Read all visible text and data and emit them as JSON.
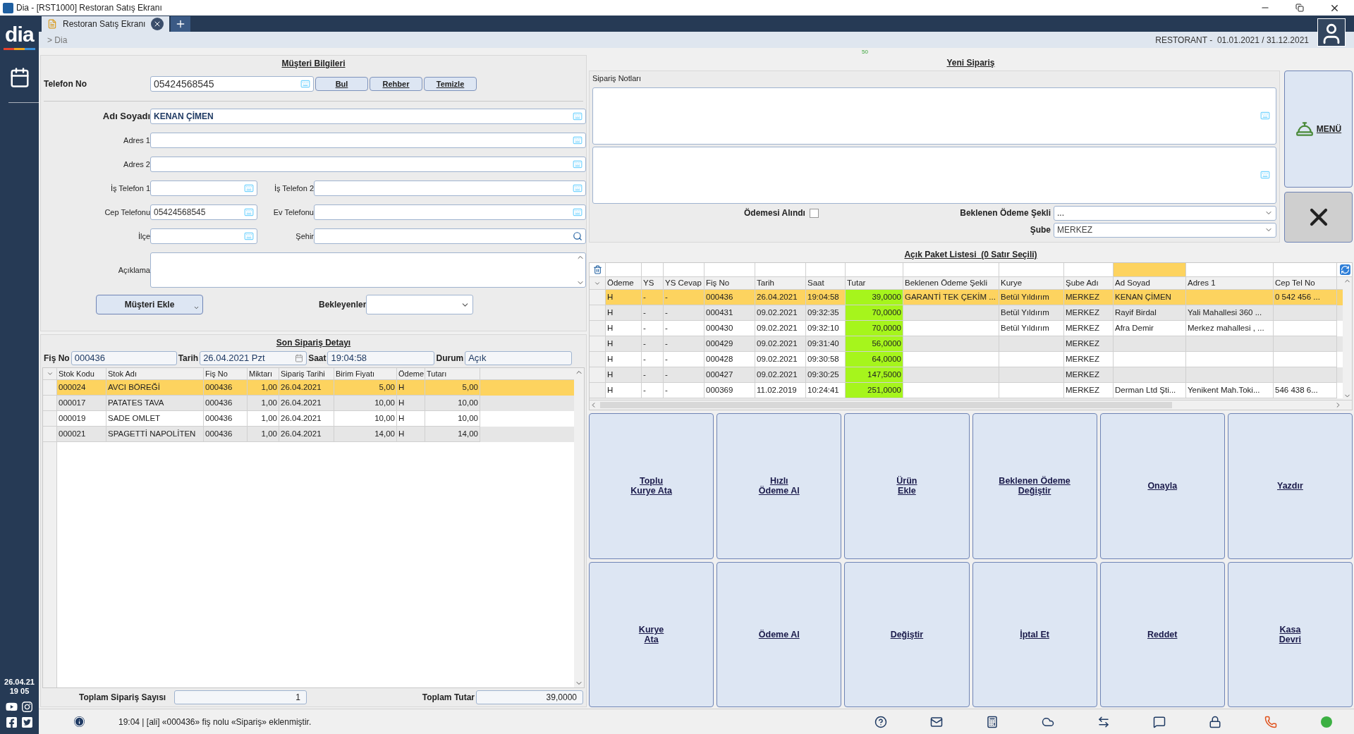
{
  "window": {
    "title": "Dia - [RST1000] Restoran Satış Ekranı"
  },
  "tabs": [
    {
      "label": "Restoran Satış Ekranı",
      "selected": true
    }
  ],
  "breadcrumb": "> Dia",
  "period": "RESTORANT -  01.01.2021 / 31.12.2021",
  "indicator": "50",
  "sidebar": {
    "logo": "dia",
    "date": "26.04.21",
    "time": "19 05"
  },
  "customer": {
    "title": "Müşteri Bilgileri",
    "phone_label": "Telefon No",
    "phone": "05424568545",
    "buttons": [
      "Bul",
      "Rehber",
      "Temizle"
    ],
    "rows": [
      {
        "fields": [
          {
            "label": "Adı Soyadı",
            "value": "KENAN ÇİMEN",
            "bold": true,
            "kind": "keyboard"
          }
        ]
      },
      {
        "fields": [
          {
            "label": "Adres 1",
            "bold": false,
            "kind": "keyboard"
          }
        ]
      },
      {
        "fields": [
          {
            "label": "Adres 2",
            "bold": false,
            "kind": "keyboard"
          }
        ]
      },
      {
        "fields": [
          {
            "label": "İş Telefon 1",
            "bold": false,
            "kind": "keyboard"
          },
          {
            "label": "İş Telefon 2",
            "bold": false,
            "kind": "keyboard"
          }
        ]
      },
      {
        "fields": [
          {
            "label": "Cep Telefonu",
            "value": "05424568545",
            "bold": false,
            "kind": "keyboard"
          },
          {
            "label": "Ev Telefonu",
            "bold": false,
            "kind": "keyboard"
          }
        ]
      },
      {
        "fields": [
          {
            "label": "İlçe",
            "bold": false,
            "kind": "keyboard"
          },
          {
            "label": "Şehir",
            "bold": false,
            "kind": "search"
          }
        ]
      }
    ],
    "note_label": "Açıklama",
    "add_button": "Müşteri Ekle",
    "waiting_label": "Bekleyenler"
  },
  "last_order": {
    "title": "Son Sipariş Detayı",
    "fields": [
      {
        "label": "Fiş No",
        "value": "000436",
        "kind": "text"
      },
      {
        "label": "Tarih",
        "value": "26.04.2021 Pzt",
        "kind": "date"
      },
      {
        "label": "Saat",
        "value": "19:04:58",
        "kind": "text"
      },
      {
        "label": "Durum",
        "value": "Açık",
        "kind": "text"
      }
    ],
    "columns": [
      "Stok Kodu",
      "Stok Adı",
      "Fiş No",
      "Miktarı",
      "Sipariş Tarihi",
      "Birim Fiyatı",
      "Ödeme",
      "Tutarı"
    ],
    "rows": [
      {
        "selected": true,
        "cells": [
          "000024",
          "AVCI BÖREĞİ",
          "000436",
          "1,00",
          "26.04.2021",
          "5,00",
          "H",
          "5,00"
        ]
      },
      {
        "selected": false,
        "cells": [
          "000017",
          "PATATES TAVA",
          "000436",
          "1,00",
          "26.04.2021",
          "10,00",
          "H",
          "10,00"
        ]
      },
      {
        "selected": false,
        "cells": [
          "000019",
          "SADE OMLET",
          "000436",
          "1,00",
          "26.04.2021",
          "10,00",
          "H",
          "10,00"
        ]
      },
      {
        "selected": false,
        "cells": [
          "000021",
          "SPAGETTİ NAPOLİTEN",
          "000436",
          "1,00",
          "26.04.2021",
          "14,00",
          "H",
          "14,00"
        ]
      }
    ],
    "count_label": "Toplam Sipariş Sayısı",
    "count": "1",
    "total_label": "Toplam Tutar",
    "total": "39,0000"
  },
  "new_order": {
    "title": "Yeni Sipariş",
    "notes_label": "Sipariş Notları",
    "paid_label": "Ödemesi Alındı",
    "paid": false,
    "payment_label": "Beklenen Ödeme Şekli",
    "payment": "...",
    "branch_label": "Şube",
    "branch": "MERKEZ",
    "menu_button": "MENÜ"
  },
  "open_list": {
    "title": "Açık Paket Listesi  (0 Satır Seçili)",
    "columns": [
      {
        "label": "Ödeme",
        "filtered": false
      },
      {
        "label": "YS",
        "filtered": false
      },
      {
        "label": "YS Cevap",
        "filtered": false
      },
      {
        "label": "Fiş No",
        "filtered": false
      },
      {
        "label": "Tarih",
        "filtered": false
      },
      {
        "label": "Saat",
        "filtered": false
      },
      {
        "label": "Tutar",
        "filtered": false
      },
      {
        "label": "Beklenen Ödeme Şekli",
        "filtered": false
      },
      {
        "label": "Kurye",
        "filtered": false
      },
      {
        "label": "Şube Adı",
        "filtered": false
      },
      {
        "label": "Ad Soyad",
        "filtered": true
      },
      {
        "label": "Adres 1",
        "filtered": false
      },
      {
        "label": "Cep Tel No",
        "filtered": false
      }
    ],
    "rows": [
      {
        "selected": true,
        "cells": [
          "H",
          "-",
          "-",
          "000436",
          "26.04.2021",
          "19:04:58",
          "39,0000",
          "GARANTİ TEK ÇEKİM ...",
          "Betül Yıldırım",
          "MERKEZ",
          "KENAN ÇİMEN",
          "",
          "0 542 456 ..."
        ]
      },
      {
        "selected": false,
        "cells": [
          "H",
          "-",
          "-",
          "000431",
          "09.02.2021",
          "09:32:35",
          "70,0000",
          "",
          "Betül Yıldırım",
          "MERKEZ",
          "Rayif Birdal",
          "Yali Mahallesi 360 ...",
          ""
        ]
      },
      {
        "selected": false,
        "cells": [
          "H",
          "-",
          "-",
          "000430",
          "09.02.2021",
          "09:32:10",
          "70,0000",
          "",
          "Betül Yıldırım",
          "MERKEZ",
          "Afra Demir",
          "Merkez mahallesi , ...",
          ""
        ]
      },
      {
        "selected": false,
        "cells": [
          "H",
          "-",
          "-",
          "000429",
          "09.02.2021",
          "09:31:40",
          "56,0000",
          "",
          "",
          "MERKEZ",
          "",
          "",
          ""
        ]
      },
      {
        "selected": false,
        "cells": [
          "H",
          "-",
          "-",
          "000428",
          "09.02.2021",
          "09:30:58",
          "64,0000",
          "",
          "",
          "MERKEZ",
          "",
          "",
          ""
        ]
      },
      {
        "selected": false,
        "cells": [
          "H",
          "-",
          "-",
          "000427",
          "09.02.2021",
          "09:30:25",
          "147,5000",
          "",
          "",
          "MERKEZ",
          "",
          "",
          ""
        ]
      },
      {
        "selected": false,
        "cells": [
          "H",
          "-",
          "-",
          "000369",
          "11.02.2019",
          "10:24:41",
          "251,0000",
          "",
          "",
          "MERKEZ",
          "Derman Ltd Şti...",
          "Yenikent Mah.Toki...",
          "546 438 6..."
        ]
      }
    ]
  },
  "actions": [
    "Toplu\nKurye Ata",
    "Hızlı\nÖdeme Al",
    "Ürün\nEkle",
    "Beklenen Ödeme\nDeğiştir",
    "Onayla",
    "Yazdır",
    "Kurye\nAta",
    "Ödeme Al",
    "Değiştir",
    "İptal Et",
    "Reddet",
    "Kasa\nDevri"
  ],
  "status_bar": {
    "message": "19:04 | [ali] «000436» fiş nolu «Sipariş» eklenmiştir."
  }
}
